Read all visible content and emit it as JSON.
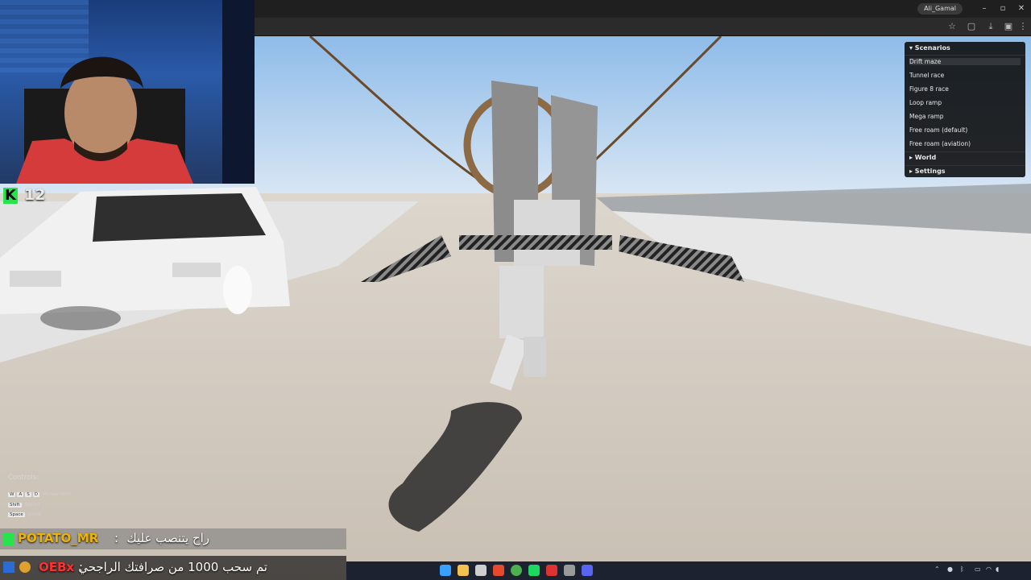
{
  "stream": {
    "platform_icon": "kick-logo-icon",
    "platform_letter": "K",
    "viewer_count": "12"
  },
  "browser": {
    "profile_label": "Ali_Gamal",
    "window_buttons": [
      "–",
      "▫",
      "✕"
    ]
  },
  "game_menu": {
    "scenarios_header": "▾ Scenarios",
    "scenarios": [
      "Drift maze",
      "Tunnel race",
      "Figure 8 race",
      "Loop ramp",
      "Mega ramp",
      "Free roam (default)",
      "Free roam (aviation)"
    ],
    "selected_index": 0,
    "world_header": "▸ World",
    "settings_header": "▸ Settings"
  },
  "controls": {
    "title": "Controls:",
    "rows": [
      {
        "keys": [
          "W",
          "A",
          "S",
          "D"
        ],
        "action": "Movement"
      },
      {
        "keys": [
          "Shift"
        ],
        "action": "Sprint"
      },
      {
        "keys": [
          "Space"
        ],
        "action": "Jump"
      }
    ]
  },
  "chat": [
    {
      "badge_icon": "kick-badge-icon",
      "name": "POTATO_MR",
      "separator": ":",
      "message": "راح يتنصب عليك"
    },
    {
      "badge_icon": "kick-badge-icon",
      "name": "OEBx",
      "separator": ":",
      "message": "تم سحب 1000 من صرافتك الراجحي"
    }
  ],
  "colors": {
    "kick_green": "#29e34d",
    "chat_name_orange": "#f0b400",
    "chat_name_red": "#ff3030",
    "sky_top": "#7fb3e6",
    "ground": "#cfc6ba"
  },
  "taskbar": {
    "apps": [
      "windows-start-icon",
      "file-explorer-icon",
      "terminal-icon",
      "brave-icon",
      "chrome-icon",
      "spotify-icon",
      "app-icon",
      "code-icon",
      "discord-icon"
    ],
    "tray_icons": [
      "chevron-up-icon",
      "mic-icon",
      "bluetooth-icon",
      "monitor-icon",
      "wifi-icon",
      "volume-icon"
    ]
  }
}
